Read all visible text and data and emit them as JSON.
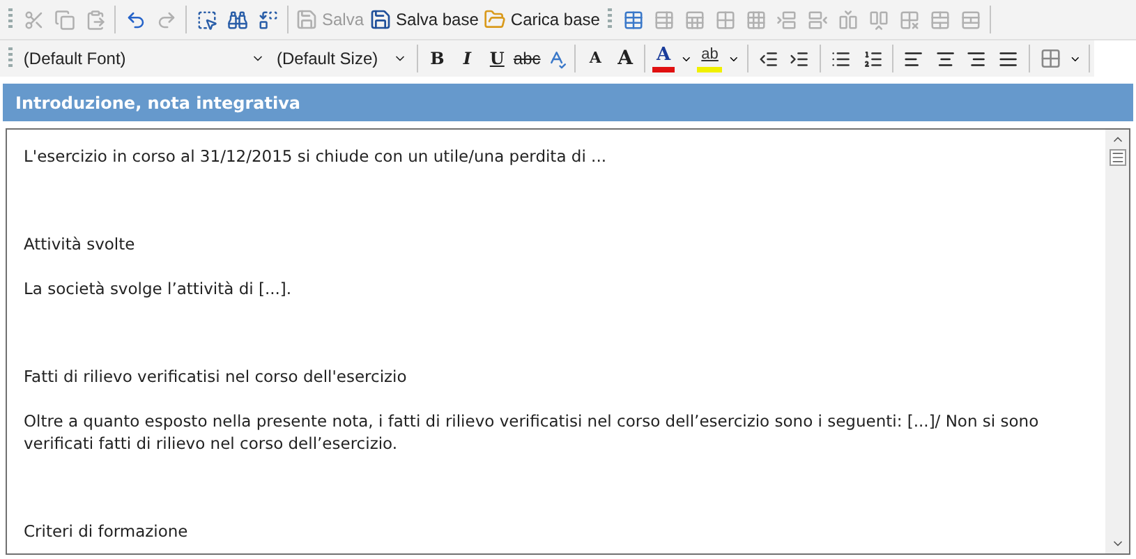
{
  "toolbar": {
    "groups": [
      [
        {
          "kind": "icon",
          "disabled": true
        },
        {
          "kind": "icon",
          "disabled": true
        },
        {
          "kind": "icon",
          "disabled": true
        }
      ],
      [
        {
          "kind": "icon",
          "disabled": false
        },
        {
          "kind": "icon",
          "disabled": true
        }
      ],
      [
        {
          "kind": "icon",
          "disabled": false
        },
        {
          "kind": "icon",
          "disabled": false
        },
        {
          "kind": "icon",
          "disabled": false
        }
      ],
      [
        {
          "kind": "labeled",
          "label": "Salva",
          "disabled": true
        },
        {
          "kind": "labeled",
          "label": "Salva base",
          "disabled": false
        },
        {
          "kind": "labeled",
          "label": "Carica base",
          "disabled": false
        }
      ],
      [
        {
          "kind": "icon",
          "disabled": false
        },
        {
          "kind": "icon",
          "disabled": true
        },
        {
          "kind": "icon",
          "disabled": true
        },
        {
          "kind": "icon",
          "disabled": true
        },
        {
          "kind": "icon",
          "disabled": true
        },
        {
          "kind": "icon",
          "disabled": true
        },
        {
          "kind": "icon",
          "disabled": true
        },
        {
          "kind": "icon",
          "disabled": true
        },
        {
          "kind": "icon",
          "disabled": true
        },
        {
          "kind": "icon",
          "disabled": true
        },
        {
          "kind": "icon",
          "disabled": true
        },
        {
          "kind": "icon",
          "disabled": true
        }
      ]
    ]
  },
  "format_bar": {
    "font": "(Default Font)",
    "size": "(Default Size)",
    "style_buttons": [
      "B",
      "I",
      "U",
      "abc"
    ],
    "shrink_label": "A",
    "grow_label": "A",
    "font_color": {
      "label": "A",
      "color": "#e01010"
    },
    "highlight": {
      "label": "ab",
      "color": "#f0f000"
    }
  },
  "section": {
    "title": "Introduzione, nota integrativa"
  },
  "editor": {
    "paragraphs": [
      {
        "kind": "body",
        "text": "L'esercizio in corso al 31/12/2015 si chiude con un utile/una perdita di ..."
      },
      {
        "kind": "heading",
        "text": "Attività svolte"
      },
      {
        "kind": "body",
        "text": "La società svolge l’attività di [...]."
      },
      {
        "kind": "heading",
        "text": "Fatti di rilievo verificatisi nel corso dell'esercizio"
      },
      {
        "kind": "body",
        "text": "Oltre a quanto esposto nella presente nota, i fatti di rilievo verificatisi nel corso dell’esercizio sono i seguenti: [...]/ Non si sono verificati fatti di rilievo nel corso dell’esercizio."
      },
      {
        "kind": "heading",
        "text": "Criteri di formazione"
      }
    ]
  }
}
